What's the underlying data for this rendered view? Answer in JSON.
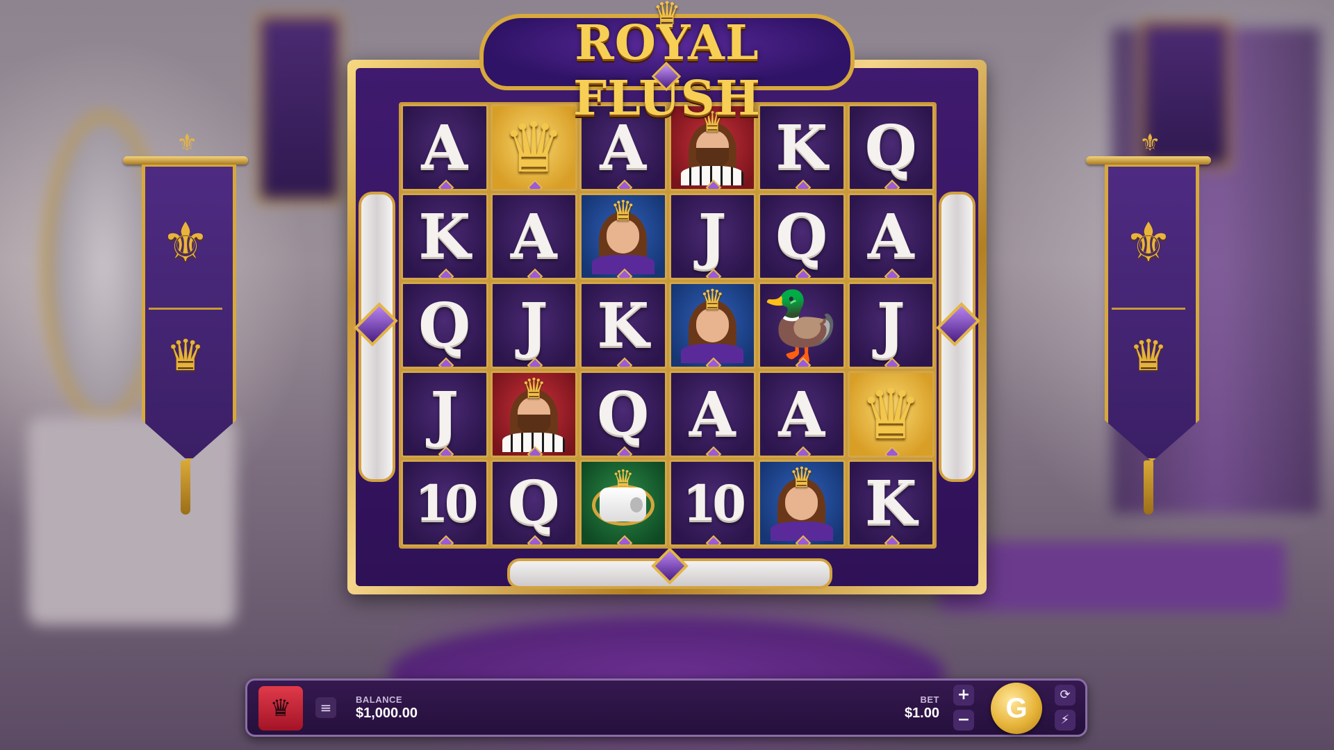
{
  "game": {
    "title": "ROYAL FLUSH"
  },
  "grid": [
    [
      {
        "symbol": "A",
        "type": "letter"
      },
      {
        "symbol": "crown",
        "type": "crown"
      },
      {
        "symbol": "A",
        "type": "letter"
      },
      {
        "symbol": "king",
        "type": "king"
      },
      {
        "symbol": "K",
        "type": "letter"
      },
      {
        "symbol": "Q",
        "type": "letter"
      }
    ],
    [
      {
        "symbol": "K",
        "type": "letter"
      },
      {
        "symbol": "A",
        "type": "letter"
      },
      {
        "symbol": "queen",
        "type": "queen"
      },
      {
        "symbol": "J",
        "type": "letter"
      },
      {
        "symbol": "Q",
        "type": "letter"
      },
      {
        "symbol": "A",
        "type": "letter"
      }
    ],
    [
      {
        "symbol": "Q",
        "type": "letter"
      },
      {
        "symbol": "J",
        "type": "letter"
      },
      {
        "symbol": "K",
        "type": "letter"
      },
      {
        "symbol": "queen",
        "type": "queen"
      },
      {
        "symbol": "duck",
        "type": "duck"
      },
      {
        "symbol": "J",
        "type": "letter"
      }
    ],
    [
      {
        "symbol": "J",
        "type": "letter"
      },
      {
        "symbol": "king",
        "type": "king"
      },
      {
        "symbol": "Q",
        "type": "letter"
      },
      {
        "symbol": "A",
        "type": "letter"
      },
      {
        "symbol": "A",
        "type": "letter"
      },
      {
        "symbol": "crown",
        "type": "crown"
      }
    ],
    [
      {
        "symbol": "10",
        "type": "letter"
      },
      {
        "symbol": "Q",
        "type": "letter"
      },
      {
        "symbol": "toilet-paper",
        "type": "scatter"
      },
      {
        "symbol": "10",
        "type": "letter"
      },
      {
        "symbol": "queen",
        "type": "queen"
      },
      {
        "symbol": "K",
        "type": "letter"
      }
    ]
  ],
  "controls": {
    "home_icon": "crown-emblem-icon",
    "menu_icon": "hamburger-icon",
    "balance_label": "BALANCE",
    "balance_value": "$1,000.00",
    "bet_label": "BET",
    "bet_value": "$1.00",
    "plus_label": "+",
    "minus_label": "−",
    "spin_label": "G",
    "autoplay_icon": "autoplay-icon",
    "turbo_icon": "lightning-icon"
  },
  "colors": {
    "frame_gold": "#d3a64a",
    "board_purple": "#2c154c",
    "spin_gold": "#e7b43a",
    "bar_purple": "#25103c",
    "home_red": "#e03a4a"
  }
}
